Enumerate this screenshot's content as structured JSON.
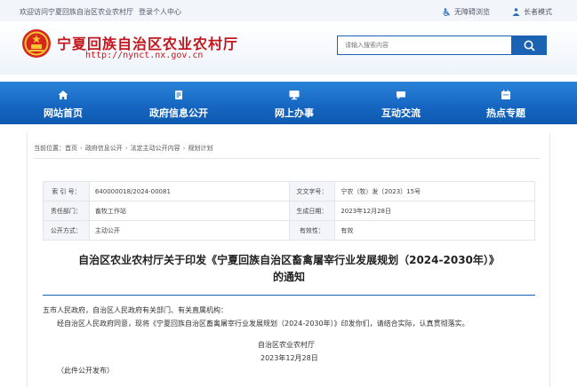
{
  "topbar": {
    "welcome": "欢迎访问宁夏回族自治区农业农村厅",
    "personal_center": "登录个人中心",
    "barrier_free": "无障碍浏览",
    "elder_mode": "长者模式"
  },
  "header": {
    "site_title": "宁夏回族自治区农业农村厅",
    "site_url": "http://nynct.nx.gov.cn",
    "search_placeholder": "请输入搜索内容"
  },
  "nav": {
    "items": [
      {
        "label": "网站首页",
        "icon": "home-icon"
      },
      {
        "label": "政府信息公开",
        "icon": "document-icon"
      },
      {
        "label": "网上办事",
        "icon": "monitor-icon"
      },
      {
        "label": "互动交流",
        "icon": "chat-icon"
      },
      {
        "label": "热点专题",
        "icon": "calendar-icon"
      }
    ]
  },
  "breadcrumb": {
    "prefix": "当前位置：",
    "items": [
      "首页",
      "政府信息公开",
      "法定主动公开内容",
      "规划计划"
    ]
  },
  "meta": {
    "rows": [
      [
        {
          "k": "索 引 号：",
          "v": "640000018/2024-00081"
        },
        {
          "k": "文文字号：",
          "v": "宁农（牧）发〔2023〕15号"
        }
      ],
      [
        {
          "k": "责任部门：",
          "v": "畜牧工作站"
        },
        {
          "k": "生成日期：",
          "v": "2023年12月28日"
        }
      ],
      [
        {
          "k": "公开方式：",
          "v": "主动公开"
        },
        {
          "k": "有效性：",
          "v": "有效"
        }
      ]
    ]
  },
  "document": {
    "title_line1": "自治区农业农村厅关于印发《宁夏回族自治区畜禽屠宰行业发展规划（2024-2030年）》",
    "title_line2": "的通知",
    "addressee": "五市人民政府，自治区人民政府有关部门、有关直属机构：",
    "paragraph": "经自治区人民政府同意，现将《宁夏回族自治区畜禽屠宰行业发展规划（2024-2030年）》印发你们，请结合实际，认真贯彻落实。",
    "signature_org": "自治区农业农村厅",
    "signature_date": "2023年12月28日",
    "note": "（此件公开发布）"
  },
  "colors": {
    "brand_red": "#c4161c",
    "nav_blue": "#1565c0",
    "accent_blue": "#1a62b3"
  }
}
